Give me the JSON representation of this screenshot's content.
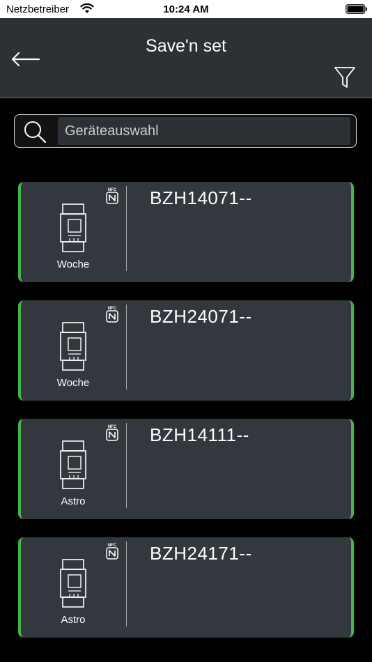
{
  "status_bar": {
    "carrier": "Netzbetreiber",
    "time": "10:24 AM"
  },
  "header": {
    "title": "Save'n set",
    "back_icon": "arrow-left-icon",
    "filter_icon": "filter-funnel-icon"
  },
  "search": {
    "placeholder": "Geräteauswahl",
    "icon": "search-icon"
  },
  "colors": {
    "accent": "#43b649",
    "card_bg": "#33373e",
    "header_bg": "#2d3034"
  },
  "devices": [
    {
      "name": "BZH14071--",
      "type": "Woche",
      "nfc": "NFC"
    },
    {
      "name": "BZH24071--",
      "type": "Woche",
      "nfc": "NFC"
    },
    {
      "name": "BZH14111--",
      "type": "Astro",
      "nfc": "NFC"
    },
    {
      "name": "BZH24171--",
      "type": "Astro",
      "nfc": "NFC"
    }
  ]
}
